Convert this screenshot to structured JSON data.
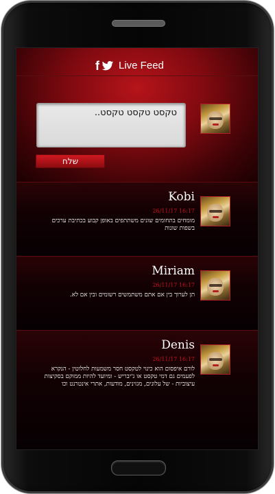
{
  "header": {
    "brand_icon_f": "f",
    "title": "Live Feed"
  },
  "compose": {
    "text": "טקסט טקסט טקסט..",
    "send_label": "שלח"
  },
  "posts": [
    {
      "name": "Kobi",
      "date": "26/11/17 16:17",
      "text": "מומחים בתחומים שונים משתתפים באופן קבוע בכתיבת ערכים בשפות שונות"
    },
    {
      "name": "Miriam",
      "date": "26/11/17 16:17",
      "text": "תן לערוך בין אם אתם משתמשים רשומים ובין אם לא."
    },
    {
      "name": "Denis",
      "date": "26/11/17 16:17",
      "text": "לורם איפסום הוא כינוי לטקסט חסר משמעות לחלוטין - הנקרא לפעמים גם דמי טקסט או ג'יבריש - ומיועד להיות ממוקם בסקיצות עיצוביות - של עלונים, מגזינים, מודעות, אתרי אינטרנט וכו"
    }
  ],
  "colors": {
    "accent": "#c8121e",
    "bg_top": "#b5141a",
    "post_bg": "#120103"
  }
}
